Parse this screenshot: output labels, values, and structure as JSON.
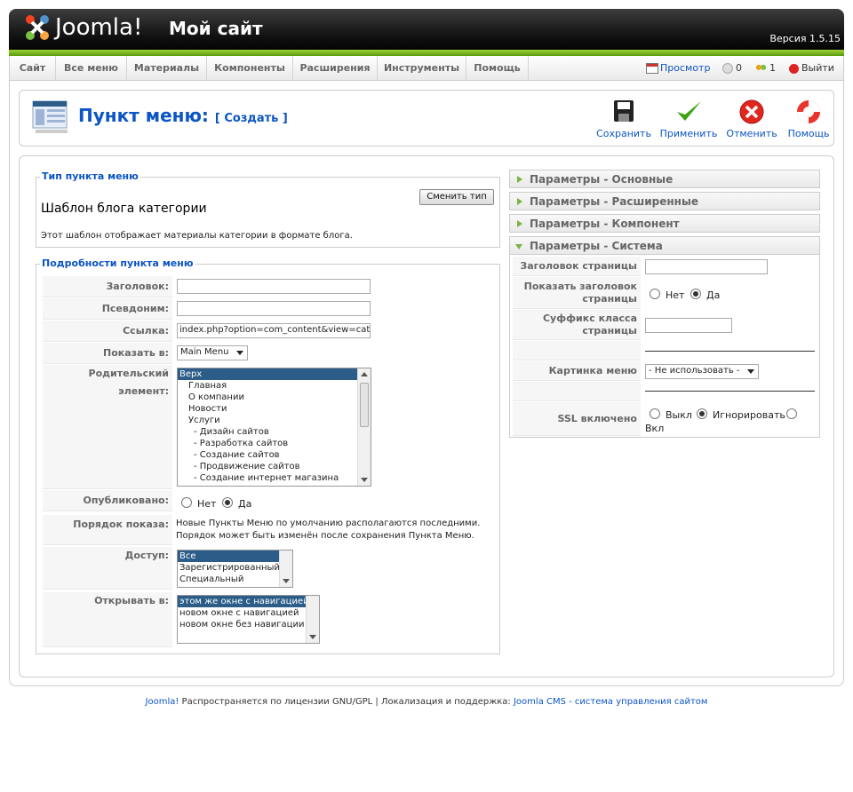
{
  "header": {
    "logo_text": "Joomla!",
    "site_name": "Мой сайт",
    "version": "Версия 1.5.15"
  },
  "menu": {
    "items": [
      "Сайт",
      "Все меню",
      "Материалы",
      "Компоненты",
      "Расширения",
      "Инструменты",
      "Помощь"
    ],
    "preview": "Просмотр",
    "messages_count": "0",
    "users_count": "1",
    "logout": "Выйти"
  },
  "toolbar": {
    "title": "Пункт меню:",
    "subtitle": "[ Создать ]",
    "buttons": [
      "Сохранить",
      "Применить",
      "Отменить",
      "Помощь"
    ]
  },
  "type_section": {
    "legend": "Тип пункта меню",
    "change_button": "Сменить тип",
    "type_title": "Шаблон блога категории",
    "type_description": "Этот шаблон отображает материалы категории в формате блога."
  },
  "details": {
    "legend": "Подробности пункта меню",
    "title_label": "Заголовок:",
    "title_value": "",
    "alias_label": "Псевдоним:",
    "alias_value": "",
    "link_label": "Ссылка:",
    "link_value": "index.php?option=com_content&view=category&layout=blog",
    "display_in_label": "Показать в:",
    "display_in_value": "Main Menu",
    "parent_label": "Родительский элемент:",
    "parent_options": [
      "Верх",
      "Главная",
      "О компании",
      "Новости",
      "Услуги",
      "- Дизайн сайтов",
      "- Разработка сайтов",
      "- Создание сайтов",
      "- Продвижение сайтов",
      "- Создание интернет магазина"
    ],
    "published_label": "Опубликовано:",
    "published_no": "Нет",
    "published_yes": "Да",
    "order_label": "Порядок показа:",
    "order_text_1": "Новые Пункты Меню по умолчанию располагаются последними.",
    "order_text_2": "Порядок может быть изменён после сохранения Пункта Меню.",
    "access_label": "Доступ:",
    "access_options": [
      "Все",
      "Зарегистрированный",
      "Специальный"
    ],
    "open_in_label": "Открывать в:",
    "open_in_options": [
      "этом же окне с навигацией",
      "новом окне с навигацией",
      "новом окне без навигации"
    ]
  },
  "params": {
    "basic": "Параметры - Основные",
    "advanced": "Параметры - Расширенные",
    "component": "Параметры - Компонент",
    "system": "Параметры - Система",
    "page_title_label": "Заголовок страницы",
    "show_page_title_label_1": "Показать заголовок",
    "show_page_title_label_2": "страницы",
    "no": "Нет",
    "yes": "Да",
    "page_class_label_1": "Суффикс класса",
    "page_class_label_2": "страницы",
    "menu_image_label": "Картинка меню",
    "menu_image_value": "- Не использовать -",
    "ssl_label": "SSL включено",
    "ssl_off": "Выкл",
    "ssl_ignore": "Игнорировать",
    "ssl_on": "Вкл"
  },
  "footer": {
    "joomla": "Joomla!",
    "license": " Распространяется по лицензии GNU/GPL | Локализация и поддержка: ",
    "support_link": "Joomla CMS - система управления сайтом"
  },
  "colors": {
    "accent_blue": "#0b55c4",
    "green": "#7cb342",
    "selected": "#2b5d88"
  }
}
